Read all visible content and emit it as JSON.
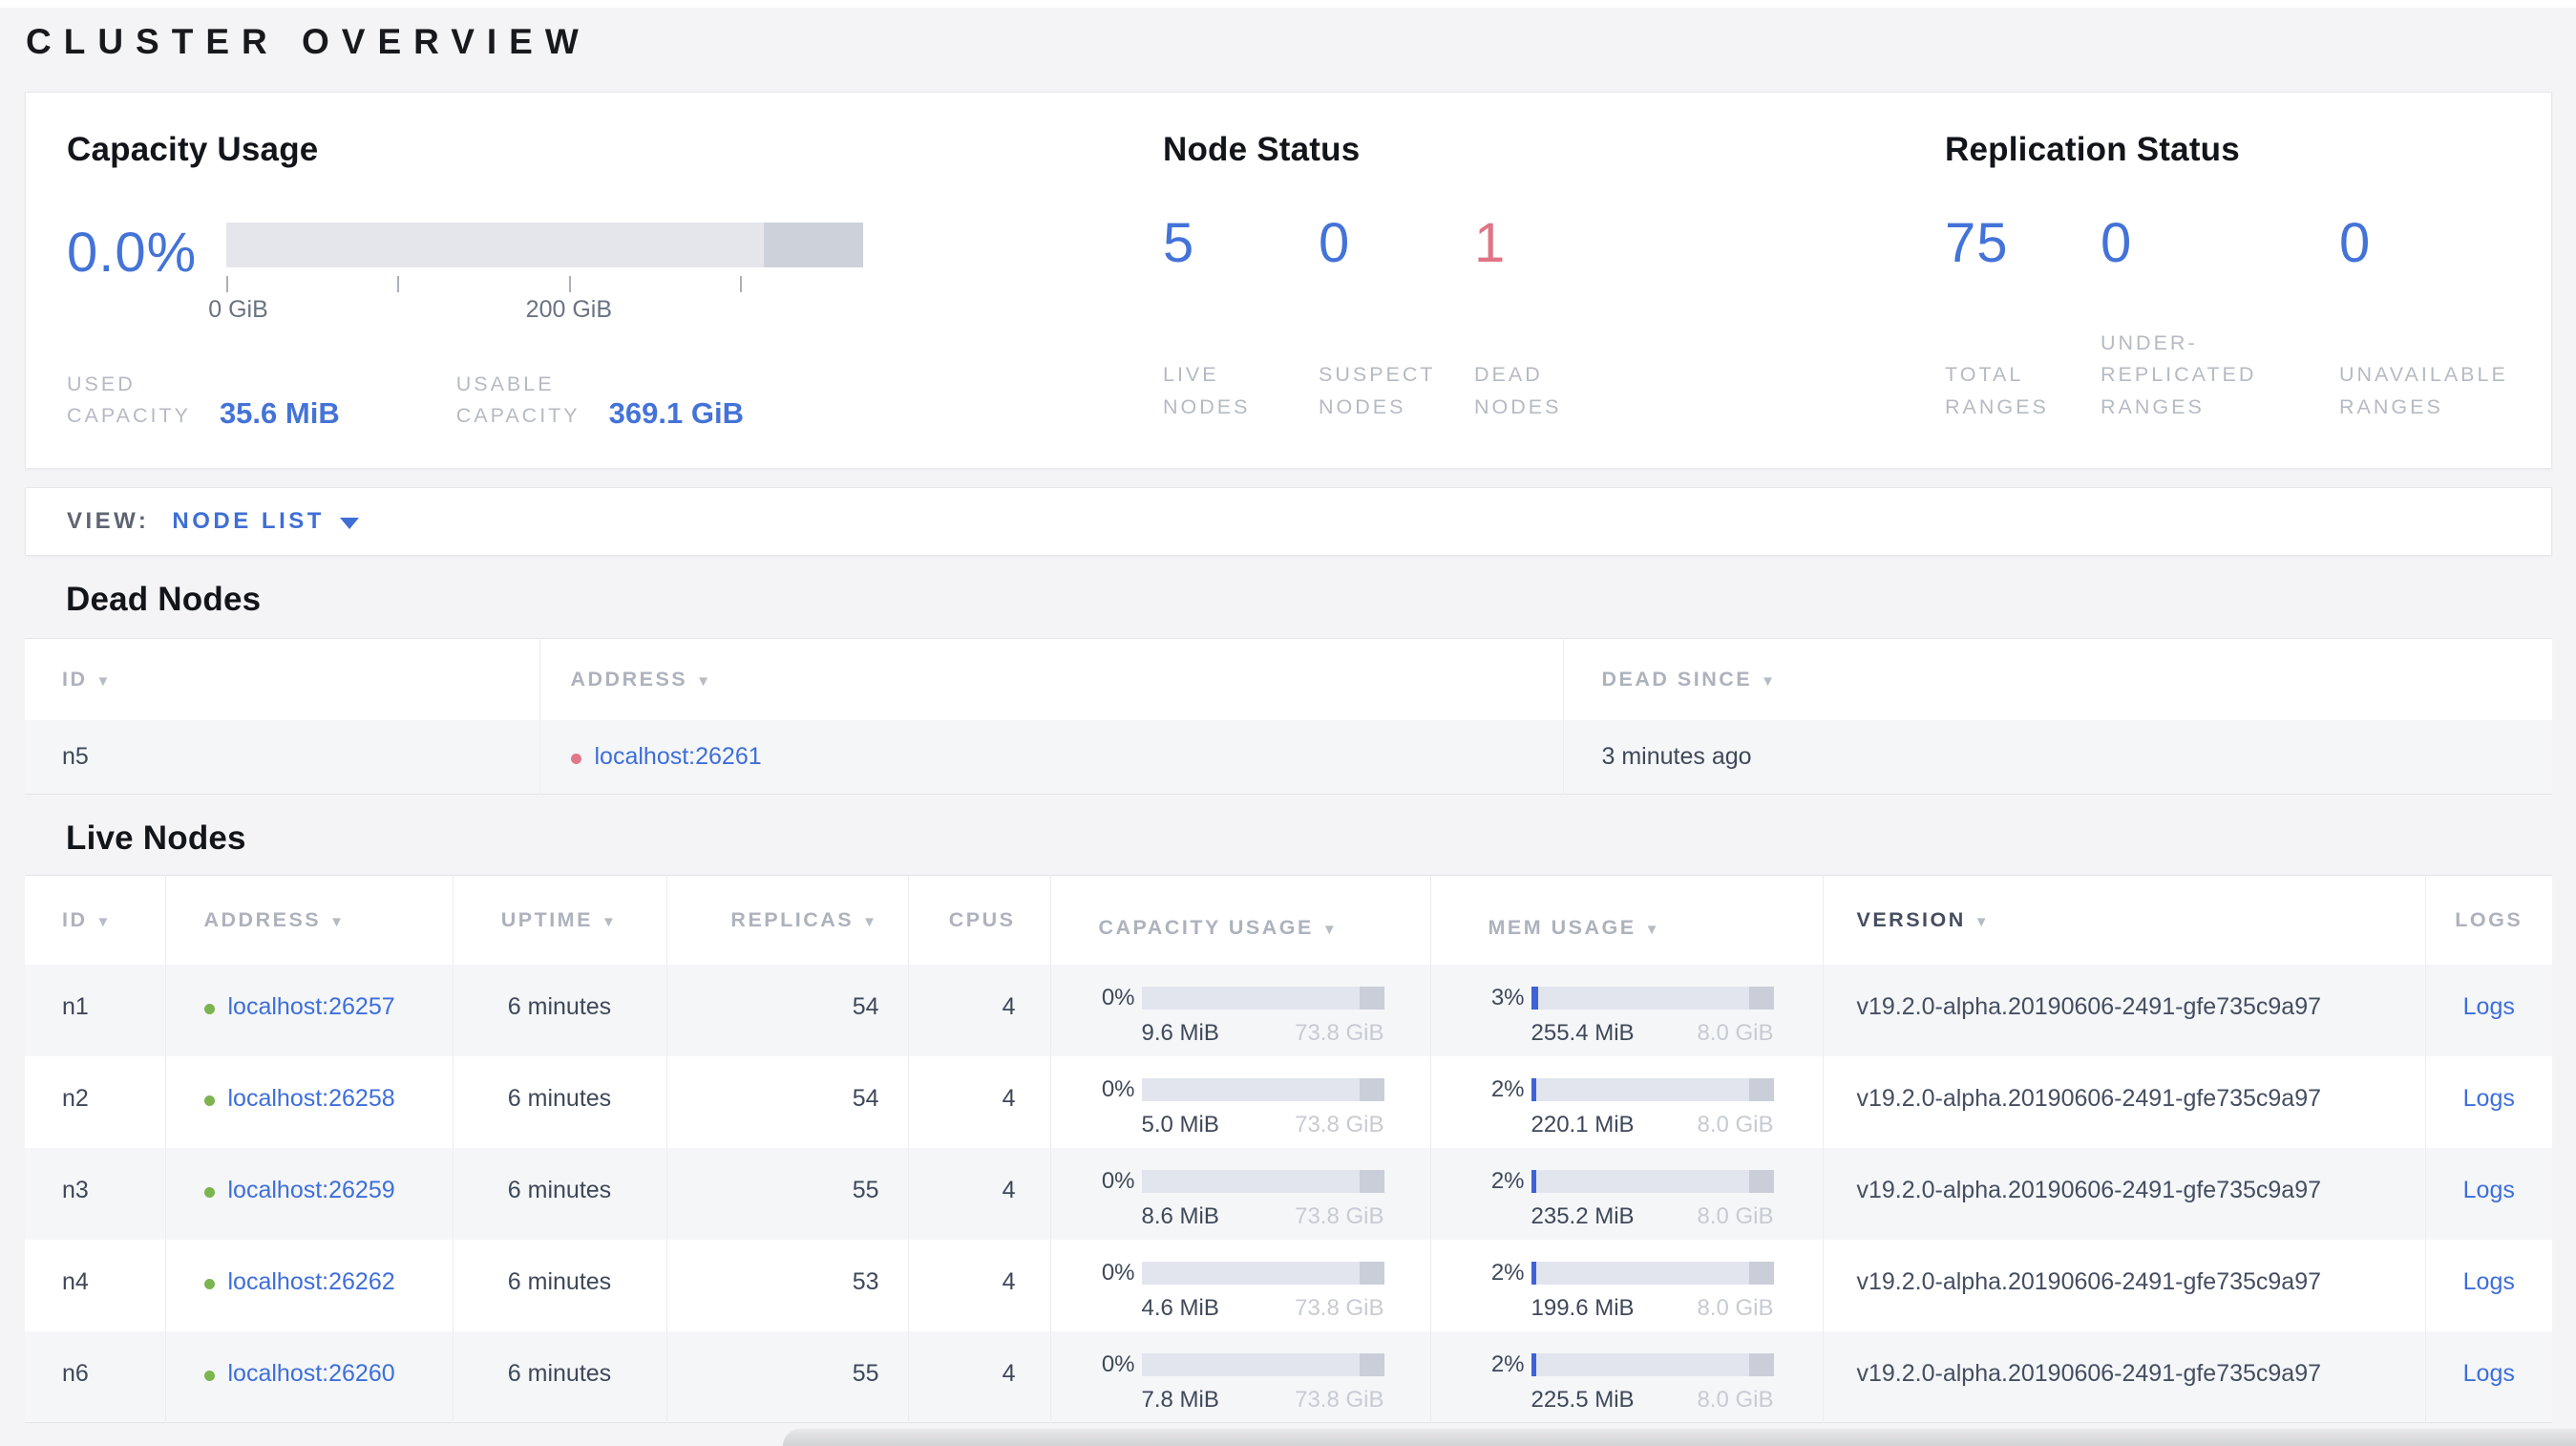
{
  "page": {
    "title": "CLUSTER OVERVIEW"
  },
  "icons": {
    "sort_arrow": "▼"
  },
  "colors": {
    "accent_blue": "#4473d8",
    "dead_red": "#df7584",
    "live_green": "#7cb450"
  },
  "summary": {
    "capacity": {
      "heading": "Capacity Usage",
      "percent": "0.0%",
      "percent_fill": 0,
      "axis_start": "0 GiB",
      "axis_mid": "200 GiB",
      "used_label": "USED\nCAPACITY",
      "used_value": "35.6 MiB",
      "usable_label": "USABLE\nCAPACITY",
      "usable_value": "369.1 GiB"
    },
    "node_status": {
      "heading": "Node Status",
      "stats": [
        {
          "value": "5",
          "label": "LIVE\nNODES"
        },
        {
          "value": "0",
          "label": "SUSPECT\nNODES"
        },
        {
          "value": "1",
          "label": "DEAD\nNODES"
        }
      ]
    },
    "replication": {
      "heading": "Replication Status",
      "stats": [
        {
          "value": "75",
          "label": "TOTAL\nRANGES"
        },
        {
          "value": "0",
          "label": "UNDER-\nREPLICATED\nRANGES"
        },
        {
          "value": "0",
          "label": "UNAVAILABLE\nRANGES"
        }
      ]
    }
  },
  "view_bar": {
    "label": "VIEW:",
    "selected": "NODE LIST"
  },
  "dead_nodes": {
    "heading": "Dead Nodes",
    "columns": [
      {
        "label": "ID"
      },
      {
        "label": "ADDRESS"
      },
      {
        "label": "DEAD SINCE"
      }
    ],
    "rows": [
      {
        "id": "n5",
        "address": "localhost:26261",
        "dead_since": "3 minutes ago"
      }
    ]
  },
  "live_nodes": {
    "heading": "Live Nodes",
    "columns": [
      {
        "label": "ID"
      },
      {
        "label": "ADDRESS"
      },
      {
        "label": "UPTIME"
      },
      {
        "label": "REPLICAS"
      },
      {
        "label": "CPUS"
      },
      {
        "label": "CAPACITY USAGE"
      },
      {
        "label": "MEM USAGE"
      },
      {
        "label": "VERSION"
      },
      {
        "label": "LOGS"
      }
    ],
    "rows": [
      {
        "id": "n1",
        "address": "localhost:26257",
        "uptime": "6 minutes",
        "replicas": "54",
        "cpus": "4",
        "capacity_pct": "0%",
        "capacity_fill": 0,
        "capacity_used": "9.6 MiB",
        "capacity_total": "73.8 GiB",
        "mem_pct": "3%",
        "mem_fill": 3,
        "mem_used": "255.4 MiB",
        "mem_total": "8.0 GiB",
        "version": "v19.2.0-alpha.20190606-2491-gfe735c9a97",
        "logs": "Logs"
      },
      {
        "id": "n2",
        "address": "localhost:26258",
        "uptime": "6 minutes",
        "replicas": "54",
        "cpus": "4",
        "capacity_pct": "0%",
        "capacity_fill": 0,
        "capacity_used": "5.0 MiB",
        "capacity_total": "73.8 GiB",
        "mem_pct": "2%",
        "mem_fill": 2,
        "mem_used": "220.1 MiB",
        "mem_total": "8.0 GiB",
        "version": "v19.2.0-alpha.20190606-2491-gfe735c9a97",
        "logs": "Logs"
      },
      {
        "id": "n3",
        "address": "localhost:26259",
        "uptime": "6 minutes",
        "replicas": "55",
        "cpus": "4",
        "capacity_pct": "0%",
        "capacity_fill": 0,
        "capacity_used": "8.6 MiB",
        "capacity_total": "73.8 GiB",
        "mem_pct": "2%",
        "mem_fill": 2,
        "mem_used": "235.2 MiB",
        "mem_total": "8.0 GiB",
        "version": "v19.2.0-alpha.20190606-2491-gfe735c9a97",
        "logs": "Logs"
      },
      {
        "id": "n4",
        "address": "localhost:26262",
        "uptime": "6 minutes",
        "replicas": "53",
        "cpus": "4",
        "capacity_pct": "0%",
        "capacity_fill": 0,
        "capacity_used": "4.6 MiB",
        "capacity_total": "73.8 GiB",
        "mem_pct": "2%",
        "mem_fill": 2,
        "mem_used": "199.6 MiB",
        "mem_total": "8.0 GiB",
        "version": "v19.2.0-alpha.20190606-2491-gfe735c9a97",
        "logs": "Logs"
      },
      {
        "id": "n6",
        "address": "localhost:26260",
        "uptime": "6 minutes",
        "replicas": "55",
        "cpus": "4",
        "capacity_pct": "0%",
        "capacity_fill": 0,
        "capacity_used": "7.8 MiB",
        "capacity_total": "73.8 GiB",
        "mem_pct": "2%",
        "mem_fill": 2,
        "mem_used": "225.5 MiB",
        "mem_total": "8.0 GiB",
        "version": "v19.2.0-alpha.20190606-2491-gfe735c9a97",
        "logs": "Logs"
      }
    ]
  }
}
